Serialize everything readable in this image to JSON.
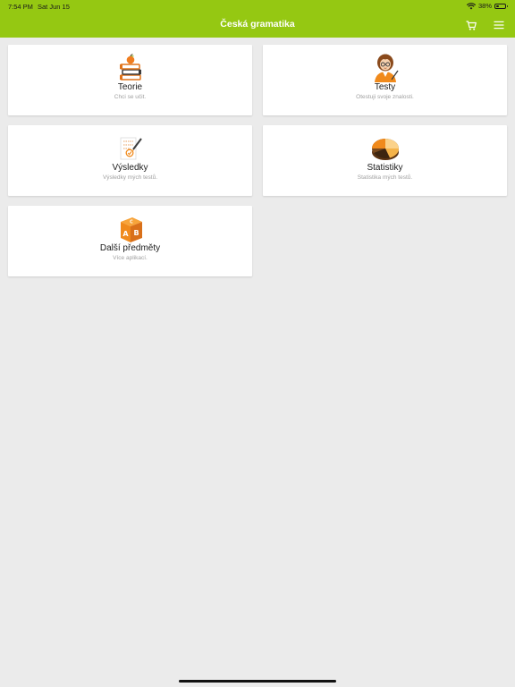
{
  "status_bar": {
    "time": "7:54 PM",
    "date": "Sat Jun 15",
    "battery": "38%",
    "battery_level": 0.38
  },
  "header": {
    "title": "Česká gramatika"
  },
  "cards": [
    {
      "title": "Teorie",
      "subtitle": "Chci se učit.",
      "icon": "books-apple-icon"
    },
    {
      "title": "Testy",
      "subtitle": "Otestuji svoje znalosti.",
      "icon": "teacher-icon"
    },
    {
      "title": "Výsledky",
      "subtitle": "Výsledky mých testů.",
      "icon": "test-sheet-icon"
    },
    {
      "title": "Statistiky",
      "subtitle": "Statistika mých testů.",
      "icon": "pie-chart-icon"
    },
    {
      "title": "Další předměty",
      "subtitle": "Více aplikací.",
      "icon": "abc-cube-icon"
    }
  ],
  "colors": {
    "header": "#95c812",
    "background": "#ebebeb",
    "card": "#ffffff",
    "accent_orange": "#f08a1c"
  }
}
